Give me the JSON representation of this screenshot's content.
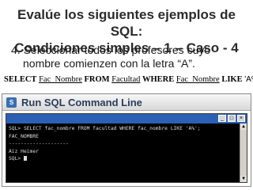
{
  "slide": {
    "title_line1": "Evalúe los siguientes ejemplos de SQL:",
    "title_line2": "Condiciones simples – 1 – Caso - 4",
    "bullet_line1": "4. Seleccionar todos los profesores cuyo",
    "bullet_line2": "nombre comienzen con la letra “A”."
  },
  "sql_example": {
    "select": "SELECT",
    "column": "Fac_Nombre",
    "from": "FROM",
    "table": "Facultad",
    "where": "WHERE",
    "column2": "Fac_Nombre",
    "like": "LIKE",
    "pattern": "'A%';"
  },
  "window": {
    "title": "Run SQL Command Line",
    "icon": "sql-icon",
    "inner_caption": "",
    "buttons": [
      "_",
      "□",
      "×"
    ]
  },
  "console": {
    "lines": [
      "SQL> SELECT fac_nombre FROM facultad WHERE fac_nombre LIKE 'A%';",
      "",
      "FAC_NOMBRE",
      "--------------------",
      "Aiz Heimer",
      "",
      "SQL> "
    ]
  },
  "colors": {
    "title_text": "#2b2b2b",
    "cmd_bar": "#2b61b5",
    "console_bg": "#000000",
    "console_text": "#dcdcdc"
  }
}
